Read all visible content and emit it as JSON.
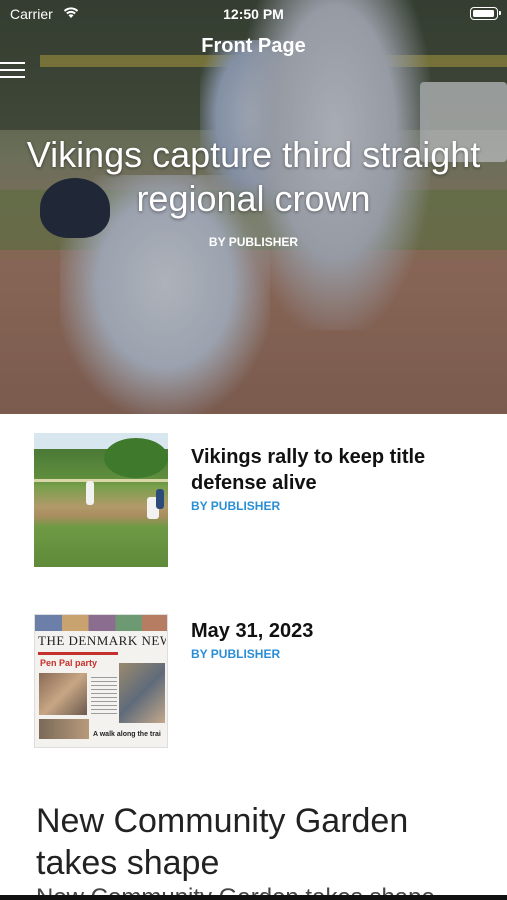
{
  "status_bar": {
    "carrier": "Carrier",
    "time": "12:50 PM"
  },
  "nav": {
    "title": "Front Page",
    "menu_icon": "hamburger-menu-icon"
  },
  "hero": {
    "title": "Vikings capture third straight regional crown",
    "byline": "BY PUBLISHER"
  },
  "articles": [
    {
      "title": "Vikings rally to keep title defense alive",
      "byline": "BY PUBLISHER",
      "thumb": "baseball-photo"
    },
    {
      "title": "May 31, 2023",
      "byline": "BY PUBLISHER",
      "thumb": "newspaper-front-page",
      "paper": {
        "masthead": "THE DENMARK NEWS",
        "headline": "Pen Pal party",
        "footer": "A walk along the trai"
      }
    }
  ],
  "feature": {
    "title": "New Community Garden takes shape",
    "excerpt": "New Community Garden takes shape"
  },
  "colors": {
    "byline_blue": "#2a8ed6",
    "paper_red": "#c4302b"
  }
}
